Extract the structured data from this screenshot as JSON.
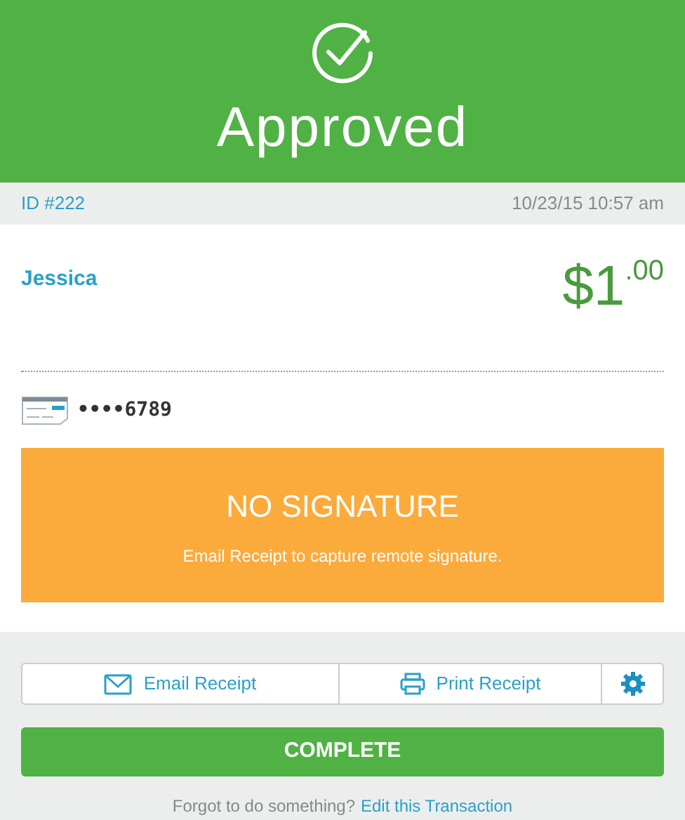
{
  "status": {
    "title": "Approved"
  },
  "meta": {
    "id": "ID #222",
    "datetime": "10/23/15 10:57 am"
  },
  "transaction": {
    "customer": "Jessica",
    "amount": "$1$^{.00}$",
    "card_number": "••••6789"
  },
  "signature": {
    "title": "NO SIGNATURE",
    "message": "Email Receipt to capture remote signature."
  },
  "actions": [
    {
      "kind": "email",
      "label": "Email Receipt"
    },
    {
      "kind": "print",
      "label": "Print Receipt"
    },
    {
      "kind": "settings"
    }
  ],
  "complete_button": "COMPLETE",
  "footer": {
    "prompt": "Forgot to do something?",
    "link": "Edit this Transaction"
  }
}
